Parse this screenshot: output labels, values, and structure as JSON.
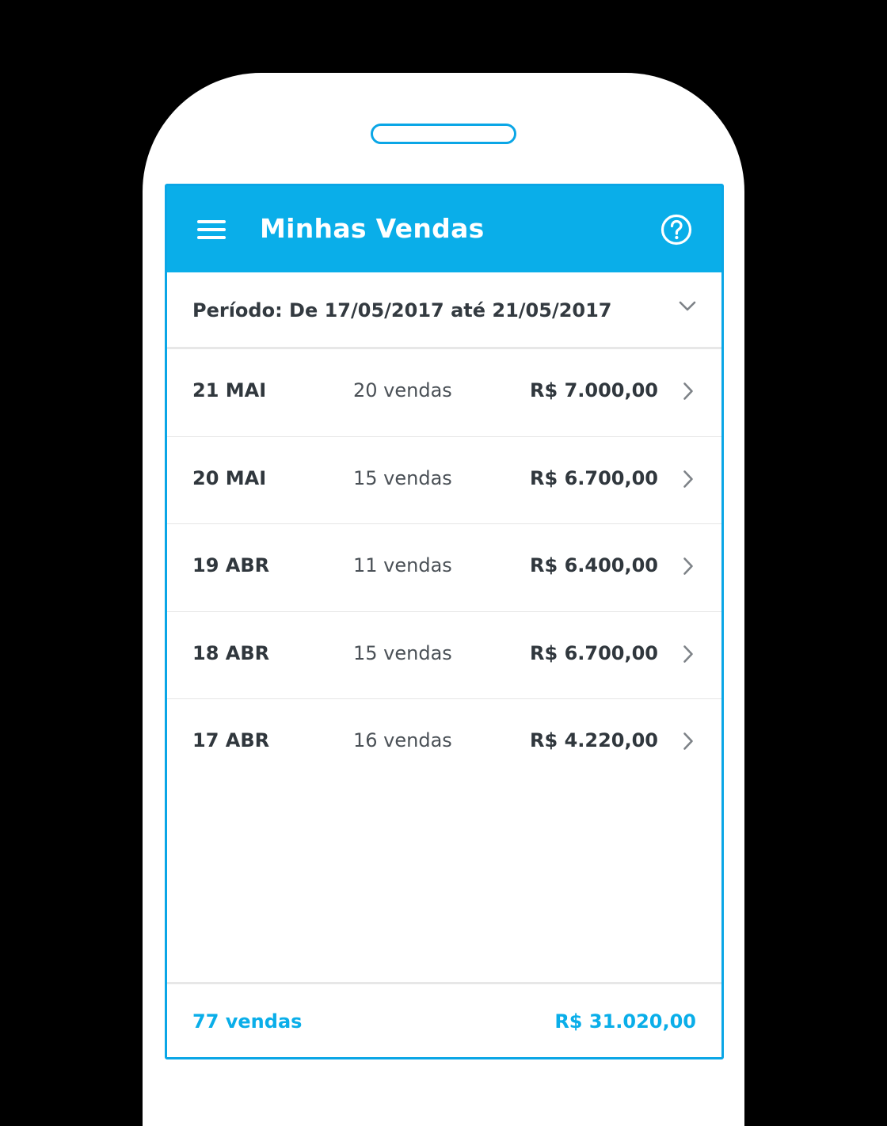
{
  "app": {
    "title": "Minhas Vendas",
    "accent_color": "#0AAEE9",
    "menu_icon": "hamburger-menu-icon",
    "help_icon": "help-circle-icon"
  },
  "period": {
    "label": "Período: De 17/05/2017 até 21/05/2017",
    "icon": "chevron-down-icon"
  },
  "sales_days": [
    {
      "date": "21 MAI",
      "count": "20 vendas",
      "value": "R$ 7.000,00"
    },
    {
      "date": "20 MAI",
      "count": "15 vendas",
      "value": "R$ 6.700,00"
    },
    {
      "date": "19 ABR",
      "count": "11 vendas",
      "value": "R$ 6.400,00"
    },
    {
      "date": "18 ABR",
      "count": "15 vendas",
      "value": "R$ 6.700,00"
    },
    {
      "date": "17 ABR",
      "count": "16 vendas",
      "value": "R$ 4.220,00"
    }
  ],
  "footer": {
    "total_count": "77 vendas",
    "total_value": "R$ 31.020,00"
  }
}
